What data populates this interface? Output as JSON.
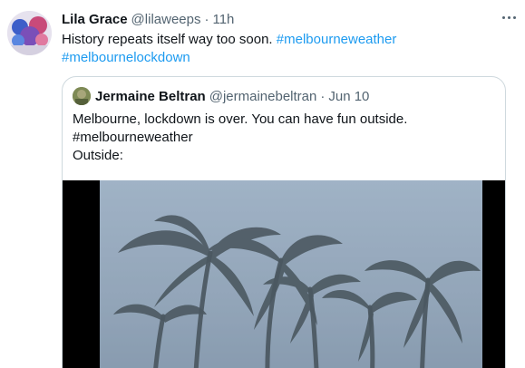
{
  "tweet": {
    "display_name": "Lila Grace",
    "handle": "@lilaweeps",
    "separator": "·",
    "time": "11h",
    "text": "History repeats itself way too soon.",
    "hashtags": [
      "#melbourneweather",
      "#melbournelockdown"
    ],
    "more_icon": "more-horizontal-icon"
  },
  "quote": {
    "display_name": "Jermaine Beltran",
    "handle": "@jermainebeltran",
    "separator": "·",
    "date": "Jun 10",
    "lines": [
      "Melbourne, lockdown is over. You can have fun outside.",
      "#melbourneweather",
      "Outside:"
    ]
  },
  "colors": {
    "link": "#1d9bf0",
    "secondary_text": "#536471",
    "border": "#cfd9de",
    "sky": "#8fa3b7"
  }
}
